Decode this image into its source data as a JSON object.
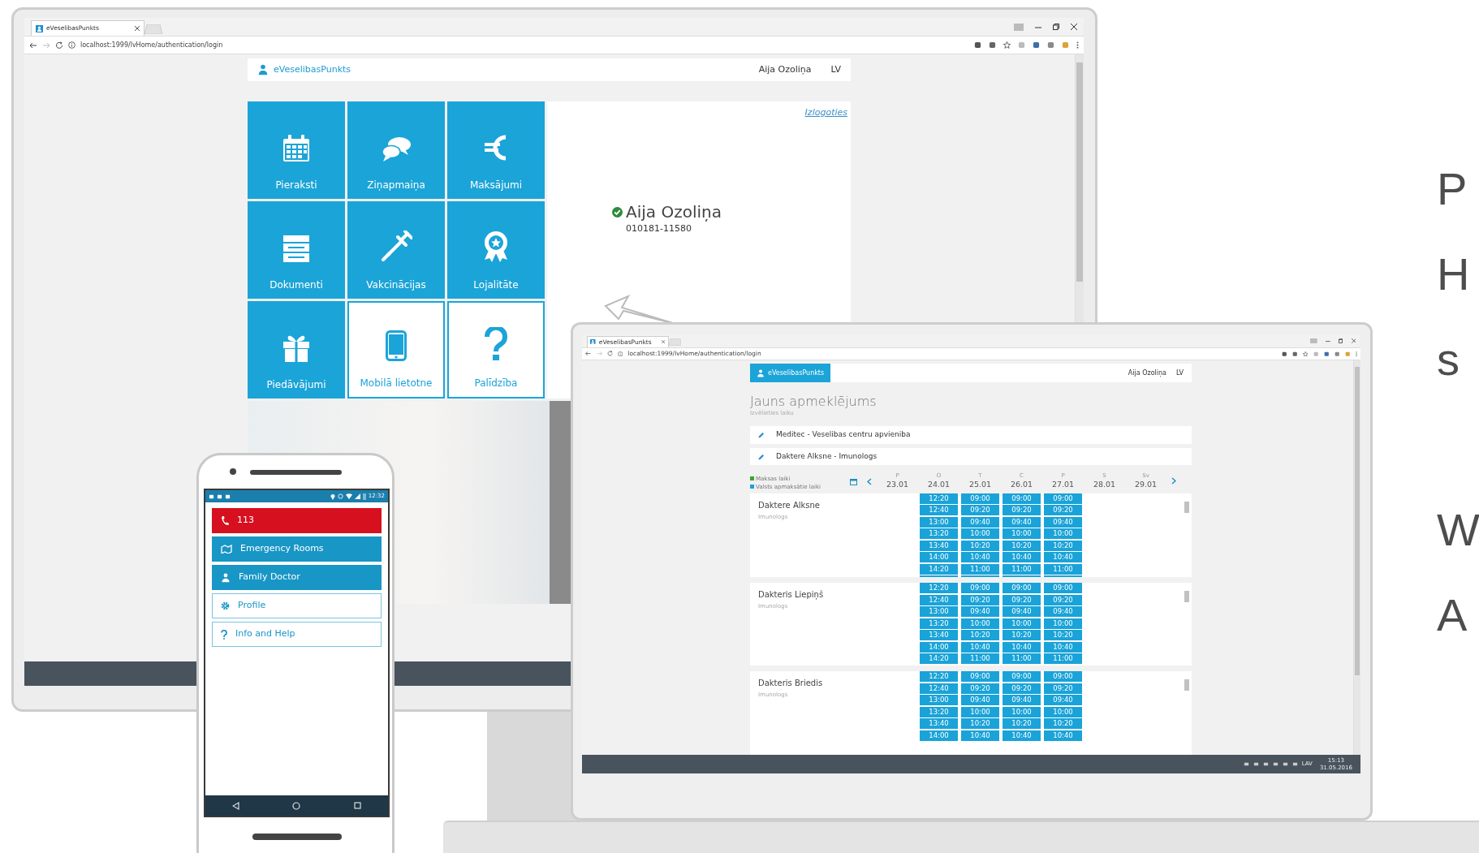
{
  "monitor": {
    "browser": {
      "tab": "eVeselibasPunkts",
      "url": "localhost:1999/lvHome/authentication/login"
    },
    "header": {
      "brand": "eVeselibasPunkts",
      "user": "Aija Ozoliņa",
      "lang": "LV"
    },
    "tiles": [
      {
        "label": "Pieraksti",
        "kind": "filled"
      },
      {
        "label": "Ziņapmaiņa",
        "kind": "filled"
      },
      {
        "label": "Maksājumi",
        "kind": "filled"
      },
      {
        "label": "Dokumenti",
        "kind": "filled"
      },
      {
        "label": "Vakcinācijas",
        "kind": "filled"
      },
      {
        "label": "Lojalitāte",
        "kind": "filled"
      },
      {
        "label": "Piedāvājumi",
        "kind": "filled"
      },
      {
        "label": "Mobilā lietotne",
        "kind": "outline"
      },
      {
        "label": "Palīdzība",
        "kind": "outline"
      }
    ],
    "logout": "Izlogoties",
    "profile": {
      "name": "Aija Ozoliņa",
      "id": "010181-11580",
      "verified": true
    }
  },
  "laptop": {
    "browser": {
      "tab": "eVeselibasPunkts",
      "url": "localhost:1999/lvHome/authentication/login"
    },
    "header": {
      "brand": "eVeselibasPunkts",
      "user": "Aija Ozoliņa",
      "lang": "LV"
    },
    "title": "Jauns apmeklējums",
    "subtitle": "Izvēlieties laiku",
    "selections": [
      "Meditec - Veselibas centru apvieniba",
      "Daktere Alksne - Imunologs"
    ],
    "legend": [
      {
        "label": "Maksas laiki",
        "color": "#3aa335"
      },
      {
        "label": "Valsts apmaksātie laiki",
        "color": "#1aa3d8"
      }
    ],
    "days": [
      {
        "weekday": "P",
        "date": "23.01"
      },
      {
        "weekday": "O",
        "date": "24.01"
      },
      {
        "weekday": "T",
        "date": "25.01"
      },
      {
        "weekday": "C",
        "date": "26.01"
      },
      {
        "weekday": "P",
        "date": "27.01"
      },
      {
        "weekday": "S",
        "date": "28.01"
      },
      {
        "weekday": "Sv",
        "date": "29.01"
      }
    ],
    "doctors": [
      {
        "name": "Daktere Alksne",
        "specialty": "Imunologs",
        "slots": [
          {
            "available": false
          },
          {
            "available": true,
            "times": [
              "12:20",
              "12:40",
              "13:00",
              "13:20",
              "13:40",
              "14:00",
              "14:20"
            ]
          },
          {
            "available": true,
            "times": [
              "09:00",
              "09:20",
              "09:40",
              "10:00",
              "10:20",
              "10:40",
              "11:00"
            ]
          },
          {
            "available": true,
            "times": [
              "09:00",
              "09:20",
              "09:40",
              "10:00",
              "10:20",
              "10:40",
              "11:00"
            ]
          },
          {
            "available": true,
            "times": [
              "09:00",
              "09:20",
              "09:40",
              "10:00",
              "10:20",
              "10:40",
              "11:00"
            ]
          },
          {
            "available": false
          },
          {
            "available": false
          }
        ]
      },
      {
        "name": "Dakteris Liepiņš",
        "specialty": "Imunologs",
        "slots": [
          {
            "available": false
          },
          {
            "available": true,
            "times": [
              "12:20",
              "12:40",
              "13:00",
              "13:20",
              "13:40",
              "14:00",
              "14:20"
            ]
          },
          {
            "available": true,
            "times": [
              "09:00",
              "09:20",
              "09:40",
              "10:00",
              "10:20",
              "10:40",
              "11:00"
            ]
          },
          {
            "available": true,
            "times": [
              "09:00",
              "09:20",
              "09:40",
              "10:00",
              "10:20",
              "10:40",
              "11:00"
            ]
          },
          {
            "available": true,
            "times": [
              "09:00",
              "09:20",
              "09:40",
              "10:00",
              "10:20",
              "10:40",
              "11:00"
            ]
          },
          {
            "available": false
          },
          {
            "available": false
          }
        ]
      },
      {
        "name": "Dakteris Briedis",
        "specialty": "Imunologs",
        "slots": [
          {
            "available": false
          },
          {
            "available": true,
            "times": [
              "12:20",
              "12:40",
              "13:00",
              "13:20",
              "13:40",
              "14:00"
            ]
          },
          {
            "available": true,
            "times": [
              "09:00",
              "09:20",
              "09:40",
              "10:00",
              "10:20",
              "10:40"
            ]
          },
          {
            "available": true,
            "times": [
              "09:00",
              "09:20",
              "09:40",
              "10:00",
              "10:20",
              "10:40"
            ]
          },
          {
            "available": true,
            "times": [
              "09:00",
              "09:20",
              "09:40",
              "10:00",
              "10:20",
              "10:40"
            ]
          },
          {
            "available": false
          },
          {
            "available": false
          }
        ]
      }
    ],
    "taskbar": {
      "lang": "LAV",
      "time": "15:13",
      "date": "31.05.2016"
    }
  },
  "phone": {
    "status_time": "12:32",
    "buttons": [
      {
        "label": "113",
        "kind": "danger"
      },
      {
        "label": "Emergency Rooms",
        "kind": "primary"
      },
      {
        "label": "Family Doctor",
        "kind": "primary"
      },
      {
        "label": "Profile",
        "kind": "outline"
      },
      {
        "label": "Info and Help",
        "kind": "outline"
      }
    ]
  },
  "slide_text": [
    "P",
    "H",
    "s",
    "W",
    "A"
  ]
}
